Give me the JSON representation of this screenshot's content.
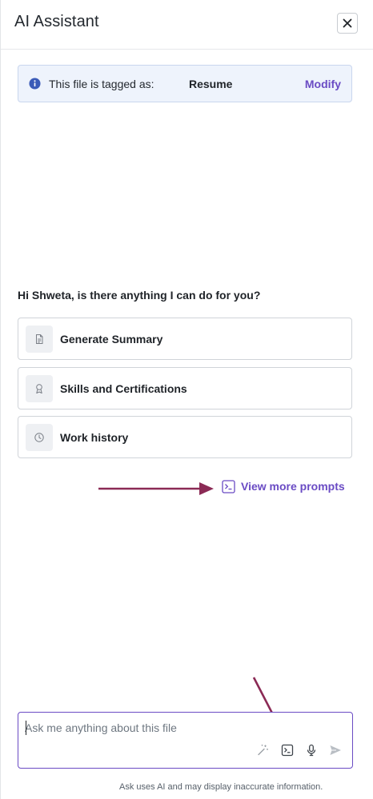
{
  "header": {
    "title": "AI Assistant",
    "close_icon": "close-icon"
  },
  "tag_banner": {
    "text": "This file is tagged as:",
    "tag": "Resume",
    "modify_label": "Modify",
    "icon": "info-icon",
    "accent": "#6a4bc4"
  },
  "greeting": "Hi Shweta, is there anything I can do for you?",
  "prompts": [
    {
      "label": "Generate Summary",
      "icon": "document-icon"
    },
    {
      "label": "Skills and Certifications",
      "icon": "award-icon"
    },
    {
      "label": "Work history",
      "icon": "clock-icon"
    }
  ],
  "view_more": {
    "label": "View more prompts",
    "icon": "terminal-icon"
  },
  "input": {
    "placeholder": "Ask me anything about this file",
    "value": ""
  },
  "toolbar": {
    "icons": [
      "magic-wand-icon",
      "terminal-icon",
      "microphone-icon",
      "send-icon"
    ]
  },
  "disclaimer": "Ask uses AI and may display inaccurate information.",
  "colors": {
    "accent": "#6a4bc4",
    "annotation_arrow": "#8b2a55",
    "banner_bg": "#eef3fc",
    "info_icon": "#3b5bb8"
  }
}
